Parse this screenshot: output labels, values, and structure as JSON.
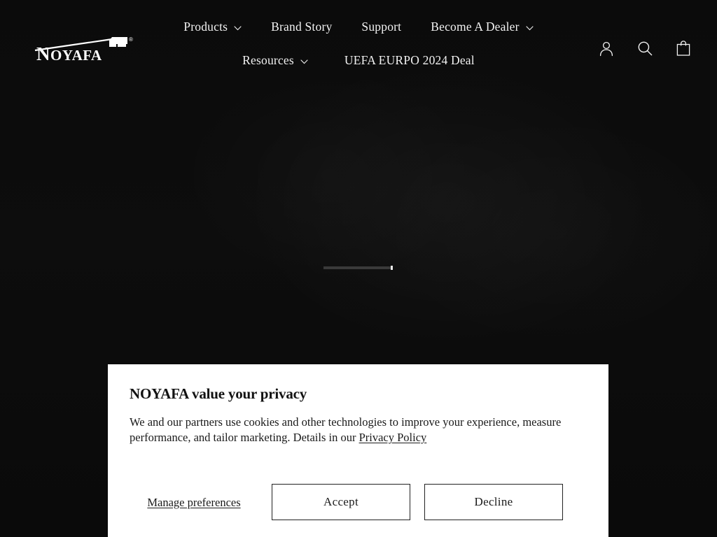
{
  "page": {
    "background_color": "#0c0c0c",
    "loading_bar": {
      "name": "page-loading-bar",
      "progress_percent": 97
    }
  },
  "header": {
    "logo": {
      "text": "NOYAFA",
      "trademark": "®",
      "icon": "rj45-connector-icon"
    },
    "nav_row_1": [
      {
        "label": "Products",
        "has_dropdown": true
      },
      {
        "label": "Brand Story",
        "has_dropdown": false
      },
      {
        "label": "Support",
        "has_dropdown": false
      },
      {
        "label": "Become A Dealer",
        "has_dropdown": true
      }
    ],
    "nav_row_2": [
      {
        "label": "Resources",
        "has_dropdown": true
      },
      {
        "label": "UEFA EURPO 2024 Deal",
        "has_dropdown": false
      }
    ],
    "icons": [
      {
        "name": "account-icon",
        "title": "Log in"
      },
      {
        "name": "search-icon",
        "title": "Search"
      },
      {
        "name": "cart-icon",
        "title": "Cart"
      }
    ]
  },
  "cookie_banner": {
    "title": "NOYAFA value your privacy",
    "body_before_link": "We and our partners use cookies and other technologies to improve your experience, measure performance, and tailor marketing. Details in our ",
    "privacy_link_label": "Privacy Policy",
    "manage_label": "Manage preferences",
    "accept_label": "Accept",
    "decline_label": "Decline",
    "background_color": "#ffffff",
    "text_color": "#1a1a1a"
  }
}
